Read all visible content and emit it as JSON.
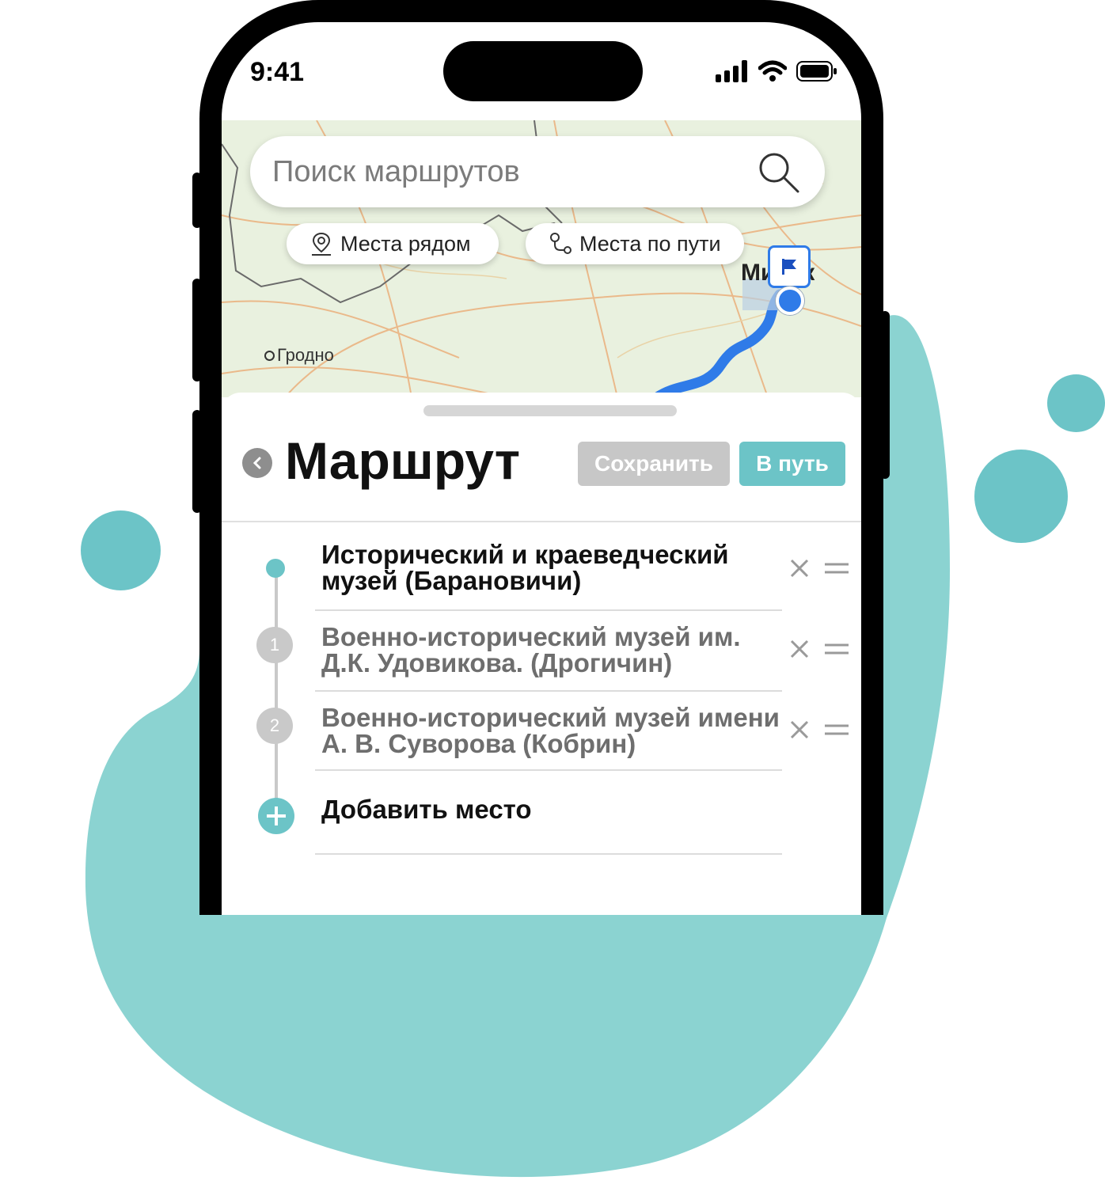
{
  "status_bar": {
    "time": "9:41"
  },
  "search": {
    "placeholder": "Поиск маршрутов"
  },
  "chips": {
    "nearby": "Места рядом",
    "along_route": "Места по пути"
  },
  "map": {
    "city_grodno": "Гродно",
    "city_minsk": "Минск"
  },
  "header": {
    "title": "Маршрут",
    "save_label": "Сохранить",
    "go_label": "В путь"
  },
  "route": {
    "items": [
      {
        "label": "Исторический и краеведческий музей (Барановичи)"
      },
      {
        "number": "1",
        "label": "Военно-исторический музей им. Д.К. Удовикова. (Дрогичин)"
      },
      {
        "number": "2",
        "label": "Военно-исторический музей имени А. В. Суворова (Кобрин)"
      }
    ],
    "add_label": "Добавить место"
  },
  "colors": {
    "accent": "#6cc4c7",
    "blob": "#8bd3d1",
    "route_line": "#2f7be8",
    "disabled_button": "#c7c7c7"
  }
}
